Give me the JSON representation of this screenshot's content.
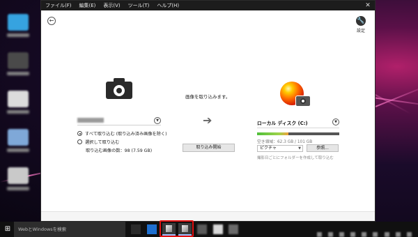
{
  "menu": {
    "items": [
      "ファイル(F)",
      "編集(E)",
      "表示(V)",
      "ツール(T)",
      "ヘルプ(H)"
    ],
    "close": "✕"
  },
  "header": {
    "back_icon": "←",
    "settings_icon": "🔧",
    "settings_label": "設定"
  },
  "source": {
    "options": [
      {
        "label": "すべて取り込む (取り込み済み画像を除く)",
        "selected": true
      },
      {
        "label": "選択して取り込む",
        "selected": false
      }
    ],
    "count_text": "取り込む画像の数：98 (7.59 GB)"
  },
  "middle": {
    "message": "画像を取り込みます。",
    "arrow": "➔",
    "start_button": "取り込み開始"
  },
  "destination": {
    "name": "ローカル ディスク (C:)",
    "storage_used_fraction": 0.385,
    "free_text": "空き領域：62.3 GB / 101 GB",
    "folder_value": "ピクチャ",
    "browse_button": "参照...",
    "note": "撮影日ごとにフォルダーを作成して取り込む"
  },
  "taskbar": {
    "start_icon": "⊞",
    "search_placeholder": "WebとWindowsを検索"
  },
  "colors": {
    "menubar": "#1c1c1c",
    "highlight": "#e01010",
    "storage_green": "#4fbf3a",
    "storage_orange": "#f3a13a"
  }
}
